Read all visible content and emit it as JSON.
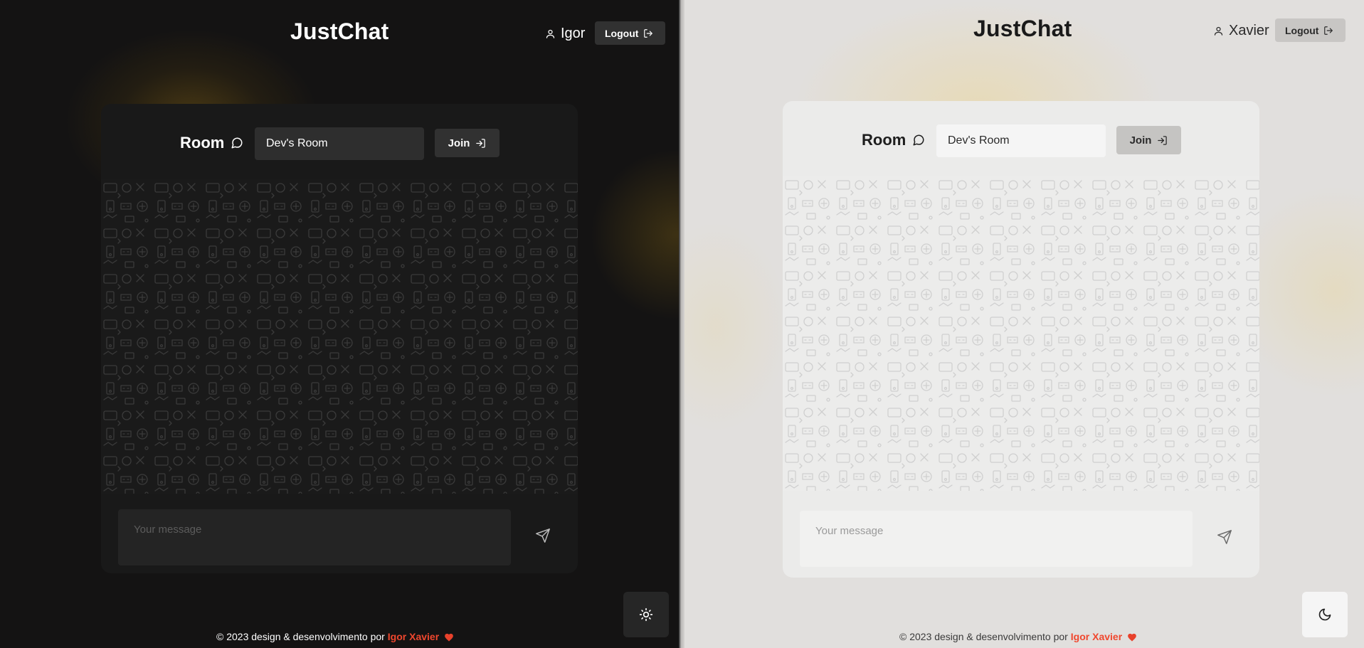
{
  "brand": "JustChat",
  "footer": {
    "text": "© 2023 design & desenvolvimento por",
    "author": "Igor Xavier"
  },
  "dark_panel": {
    "theme": "dark",
    "username": "Igor",
    "logout_label": "Logout",
    "room_label": "Room",
    "room_value": "Dev's Room",
    "join_label": "Join",
    "message_placeholder": "Your message",
    "toggle_icon": "sun-icon"
  },
  "light_panel": {
    "theme": "light",
    "username": "Xavier",
    "logout_label": "Logout",
    "room_label": "Room",
    "room_value": "Dev's Room",
    "join_label": "Join",
    "message_placeholder": "Your message",
    "toggle_icon": "moon-icon"
  },
  "colors": {
    "dark_bg": "#141313",
    "light_bg": "#e1dfdd",
    "accent_author": "#f0472e",
    "glow": "#8a6a1a"
  }
}
